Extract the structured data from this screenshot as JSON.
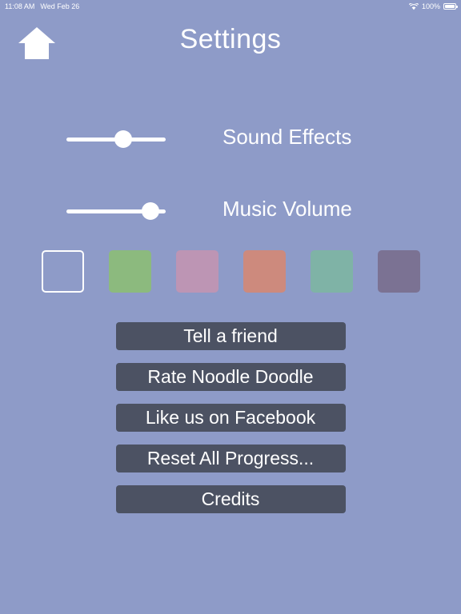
{
  "statusbar": {
    "time": "11:08 AM",
    "date": "Wed Feb 26",
    "wifi_icon": "wifi-icon",
    "battery_level": "100%",
    "battery_icon": "battery-icon"
  },
  "header": {
    "home_icon": "home-icon",
    "title": "Settings"
  },
  "sliders": [
    {
      "label": "Sound Effects",
      "value": 57,
      "icon": "slider-knob"
    },
    {
      "label": "Music Volume",
      "value": 85,
      "icon": "slider-knob"
    }
  ],
  "colors": {
    "accent_background": "#8e9bc8",
    "button_background": "#4c5263",
    "text": "#ffffff",
    "swatches": [
      {
        "name": "swatch-none",
        "hex": ""
      },
      {
        "name": "swatch-green",
        "hex": "#8cba7e"
      },
      {
        "name": "swatch-mauve",
        "hex": "#bd95b4"
      },
      {
        "name": "swatch-salmon",
        "hex": "#cd8a7d"
      },
      {
        "name": "swatch-teal",
        "hex": "#7fb3a6"
      },
      {
        "name": "swatch-purple",
        "hex": "#7b7293"
      }
    ]
  },
  "buttons": [
    {
      "label": "Tell a friend"
    },
    {
      "label": "Rate Noodle Doodle"
    },
    {
      "label": "Like us on Facebook"
    },
    {
      "label": "Reset All Progress..."
    },
    {
      "label": "Credits"
    }
  ]
}
